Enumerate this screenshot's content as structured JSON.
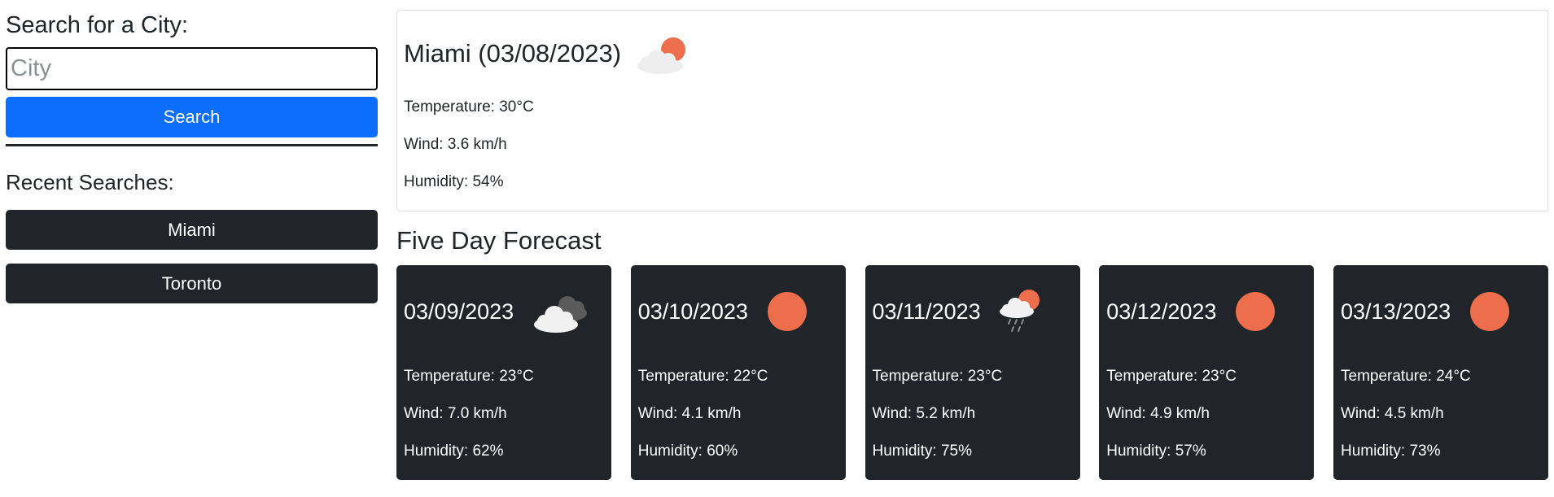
{
  "search": {
    "heading": "Search for a City:",
    "placeholder": "City",
    "value": "",
    "button_label": "Search"
  },
  "recent": {
    "heading": "Recent Searches:",
    "items": [
      {
        "label": "Miami"
      },
      {
        "label": "Toronto"
      }
    ]
  },
  "current": {
    "title": "Miami (03/08/2023)",
    "icon": "partly-cloudy-icon",
    "temperature": "Temperature: 30°C",
    "wind": "Wind: 3.6 km/h",
    "humidity": "Humidity: 54%"
  },
  "forecast": {
    "heading": "Five Day Forecast",
    "days": [
      {
        "date": "03/09/2023",
        "icon": "clouds-icon",
        "temperature": "Temperature: 23°C",
        "wind": "Wind: 7.0 km/h",
        "humidity": "Humidity: 62%"
      },
      {
        "date": "03/10/2023",
        "icon": "sun-icon",
        "temperature": "Temperature: 22°C",
        "wind": "Wind: 4.1 km/h",
        "humidity": "Humidity: 60%"
      },
      {
        "date": "03/11/2023",
        "icon": "sun-rain-icon",
        "temperature": "Temperature: 23°C",
        "wind": "Wind: 5.2 km/h",
        "humidity": "Humidity: 75%"
      },
      {
        "date": "03/12/2023",
        "icon": "sun-icon",
        "temperature": "Temperature: 23°C",
        "wind": "Wind: 4.9 km/h",
        "humidity": "Humidity: 57%"
      },
      {
        "date": "03/13/2023",
        "icon": "sun-icon",
        "temperature": "Temperature: 24°C",
        "wind": "Wind: 4.5 km/h",
        "humidity": "Humidity: 73%"
      }
    ]
  },
  "colors": {
    "primary_button": "#0d6efd",
    "dark": "#212529",
    "sun": "#ec6e4c",
    "cloud_light": "#f1f1f1",
    "cloud_dark": "#5b5b5b"
  }
}
